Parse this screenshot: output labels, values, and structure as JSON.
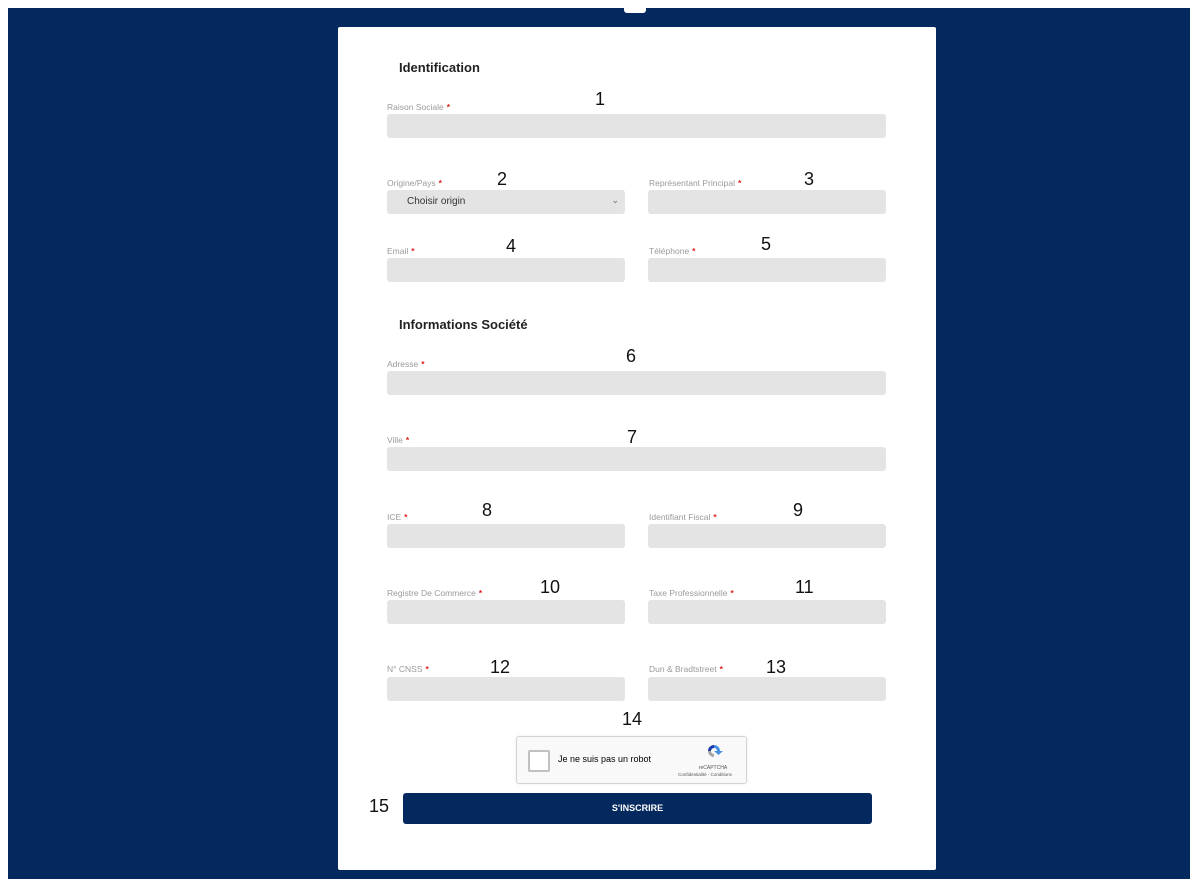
{
  "form": {
    "section_identification": "Identification",
    "section_societe": "Informations Société",
    "required_mark": "*",
    "fields": {
      "raison_sociale": {
        "label": "Raison Sociale",
        "number": "1"
      },
      "origine_pays": {
        "label": "Origine/Pays",
        "number": "2",
        "selected": "Choisir origin"
      },
      "representant": {
        "label": "Représentant Principal",
        "number": "3"
      },
      "email": {
        "label": "Email",
        "number": "4"
      },
      "telephone": {
        "label": "Téléphone",
        "number": "5"
      },
      "adresse": {
        "label": "Adresse",
        "number": "6"
      },
      "ville": {
        "label": "Ville",
        "number": "7"
      },
      "ice": {
        "label": "ICE",
        "number": "8"
      },
      "identifiant_fiscal": {
        "label": "Identifiant Fiscal",
        "number": "9"
      },
      "registre_commerce": {
        "label": "Registre De Commerce",
        "number": "10"
      },
      "taxe_pro": {
        "label": "Taxe Professionnelle",
        "number": "11"
      },
      "cnss": {
        "label": "N° CNSS",
        "number": "12"
      },
      "dun": {
        "label": "Dun & Bradtstreet",
        "number": "13"
      }
    },
    "captcha": {
      "number": "14",
      "checkbox_label": "Je ne suis pas un robot",
      "brand": "reCAPTCHA",
      "terms": "Confidentialité - Conditions"
    },
    "submit": {
      "number": "15",
      "label": "S'INSCRIRE"
    }
  },
  "colors": {
    "background": "#04295e",
    "input": "#e4e4e4",
    "required": "#e0201d",
    "button": "#04295e"
  },
  "icons": {
    "select": "chevron-down-icon",
    "captcha": "recaptcha-logo-icon"
  }
}
